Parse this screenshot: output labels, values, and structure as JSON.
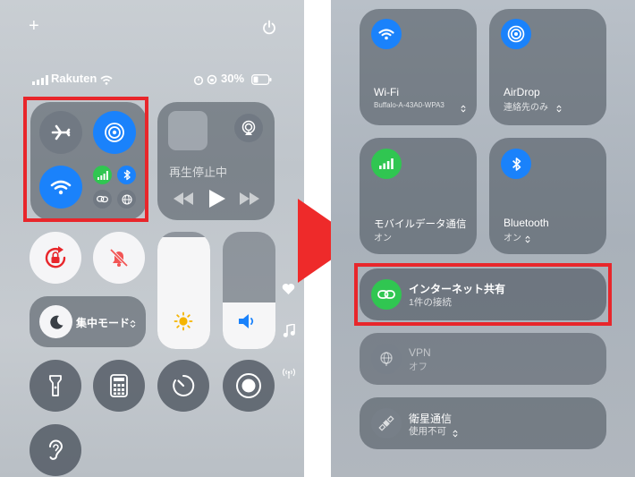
{
  "left": {
    "top_plus": "+",
    "carrier": "Rakuten",
    "battery": "30%",
    "media_status": "再生停止中",
    "focus_label": "集中モード",
    "chevron": "⌃⌄"
  },
  "right": {
    "wifi": {
      "label": "Wi-Fi",
      "sub": "Buffalo-A-43A0-WPA3"
    },
    "airdrop": {
      "label": "AirDrop",
      "sub": "連絡先のみ"
    },
    "cellular": {
      "label": "モバイルデータ通信",
      "sub": "オン"
    },
    "bluetooth": {
      "label": "Bluetooth",
      "sub": "オン"
    },
    "hotspot": {
      "label": "インターネット共有",
      "sub": "1件の接続"
    },
    "vpn": {
      "label": "VPN",
      "sub": "オフ"
    },
    "satellite": {
      "label": "衛星通信",
      "sub": "使用不可"
    }
  },
  "colors": {
    "highlight": "#e8262b",
    "blue": "#1a82fb",
    "green": "#30c651",
    "arrow": "#ee2a2a"
  }
}
